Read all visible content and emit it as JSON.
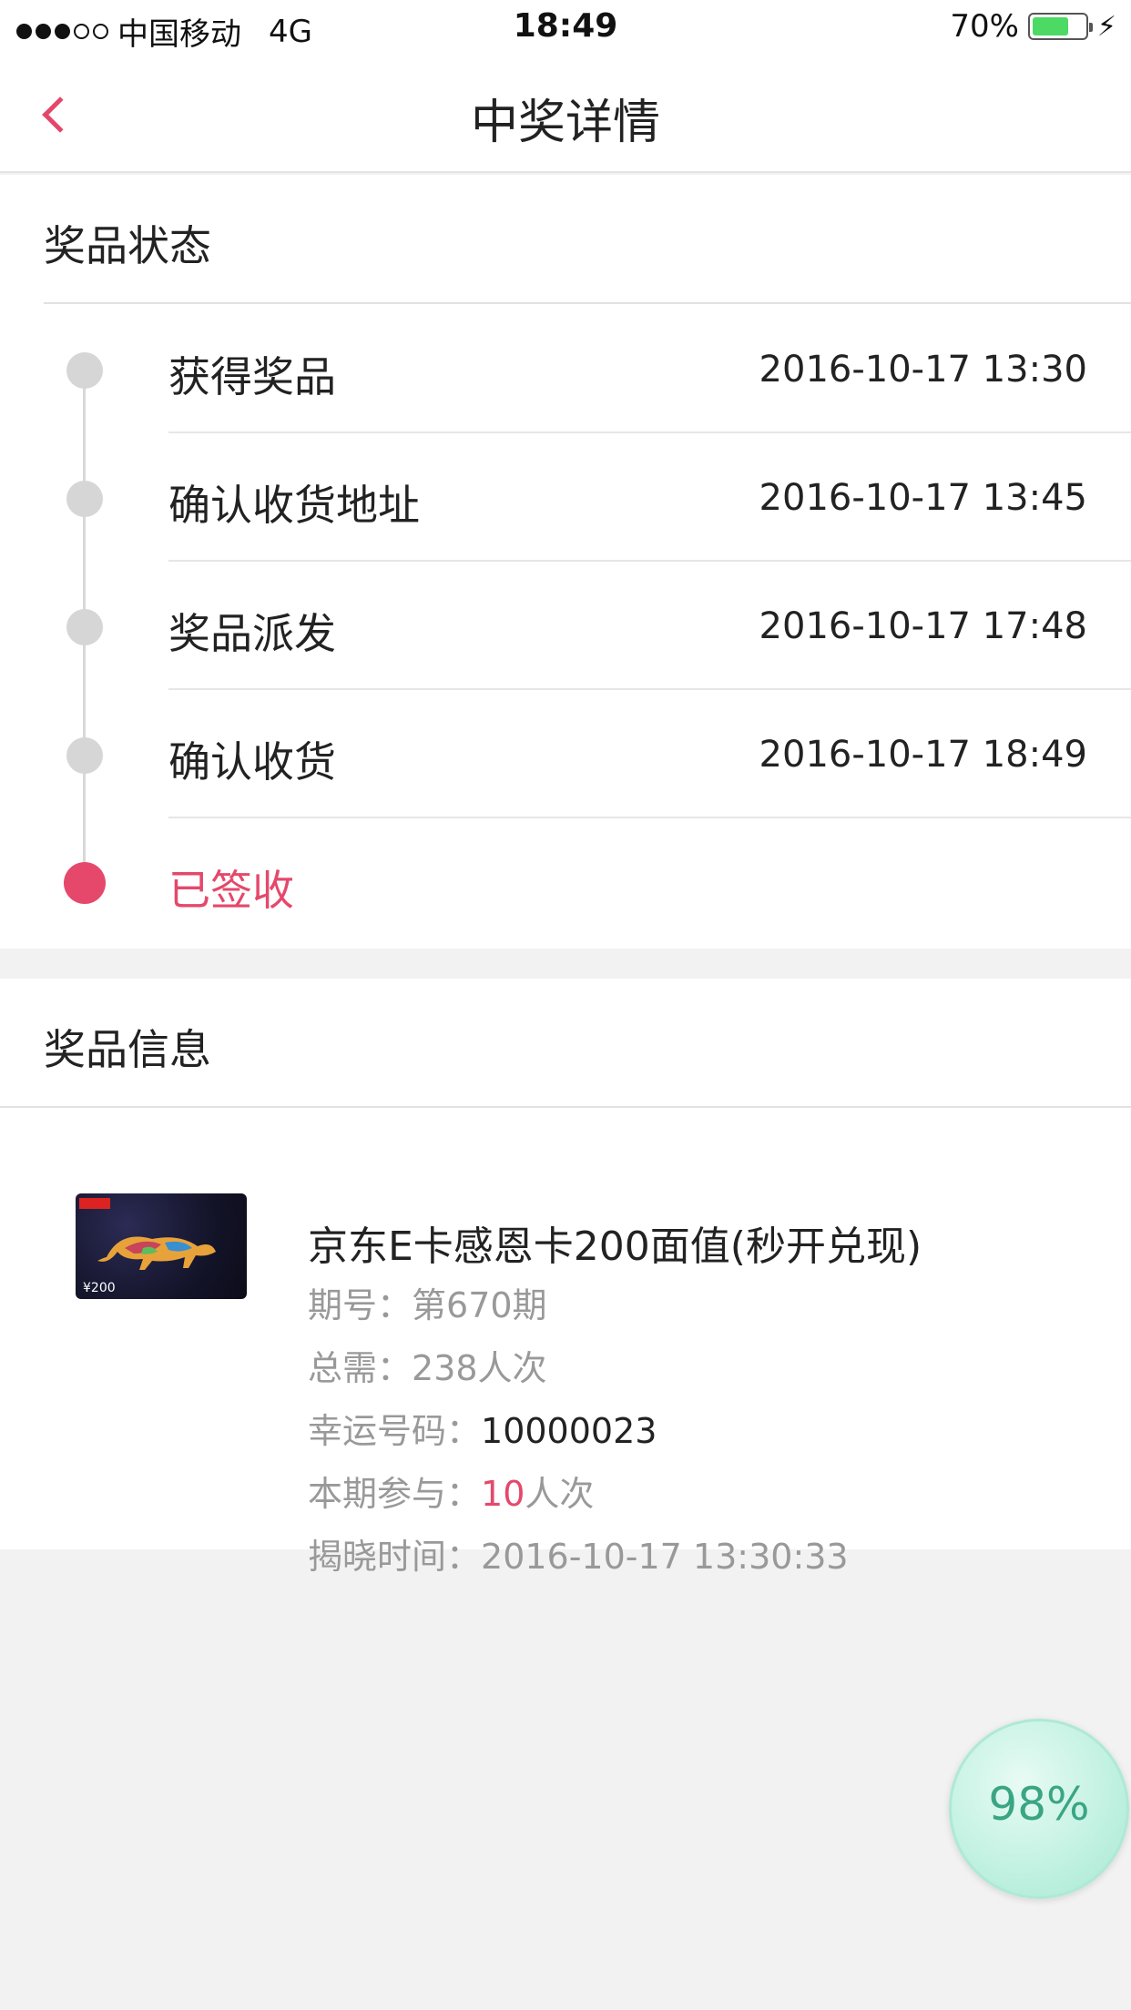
{
  "status_bar": {
    "carrier": "中国移动",
    "network": "4G",
    "time": "18:49",
    "battery": "70%",
    "battery_level": 0.7
  },
  "nav": {
    "title": "中奖详情"
  },
  "status_section": {
    "title": "奖品状态",
    "steps": [
      {
        "label": "获得奖品",
        "time": "2016-10-17 13:30"
      },
      {
        "label": "确认收货地址",
        "time": "2016-10-17 13:45"
      },
      {
        "label": "奖品派发",
        "time": "2016-10-17 17:48"
      },
      {
        "label": "确认收货",
        "time": "2016-10-17 18:49"
      },
      {
        "label": "已签收",
        "time": ""
      }
    ]
  },
  "info_section": {
    "title": "奖品信息",
    "prize_name": "京东E卡感恩卡200面值(秒开兑现)",
    "card_amount": "¥200",
    "period_label": "期号：",
    "period_value": "第670期",
    "total_label": "总需：",
    "total_value": "238人次",
    "lucky_label": "幸运号码：",
    "lucky_value": "10000023",
    "participate_label": "本期参与：",
    "participate_count": "10",
    "participate_unit": "人次",
    "reveal_label": "揭晓时间：",
    "reveal_value": "2016-10-17 13:30:33"
  },
  "float_badge": {
    "text": "98%"
  },
  "colors": {
    "accent": "#e5486b",
    "badge_text": "#3aa583"
  }
}
